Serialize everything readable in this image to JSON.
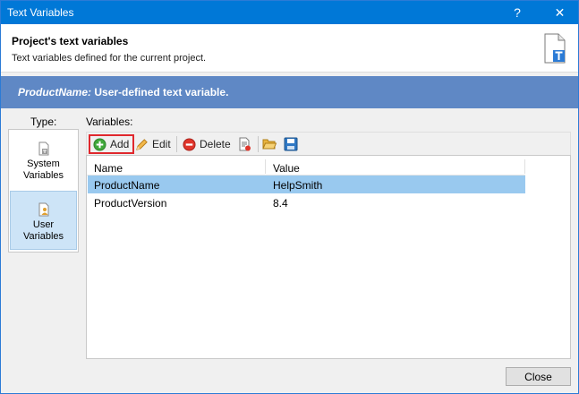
{
  "window": {
    "title": "Text Variables",
    "help_label": "?",
    "close_label": "✕"
  },
  "header": {
    "title": "Project's text variables",
    "subtitle": "Text variables defined for the current project."
  },
  "banner": {
    "name": "ProductName:",
    "description": " User-defined text variable."
  },
  "type_panel": {
    "label": "Type:",
    "items": [
      {
        "label_line1": "System",
        "label_line2": "Variables",
        "selected": false
      },
      {
        "label_line1": "User",
        "label_line2": "Variables",
        "selected": true
      }
    ]
  },
  "variables": {
    "label": "Variables:",
    "toolbar": {
      "add_label": "Add",
      "edit_label": "Edit",
      "delete_label": "Delete"
    },
    "columns": [
      "Name",
      "Value"
    ],
    "rows": [
      {
        "name": "ProductName",
        "value": "HelpSmith",
        "selected": true
      },
      {
        "name": "ProductVersion",
        "value": "8.4",
        "selected": false
      }
    ]
  },
  "footer": {
    "close_label": "Close"
  },
  "colors": {
    "titlebar": "#0078d7",
    "banner": "#5f88c5",
    "selection": "#99c9ef",
    "highlight_border": "#e0282d"
  }
}
